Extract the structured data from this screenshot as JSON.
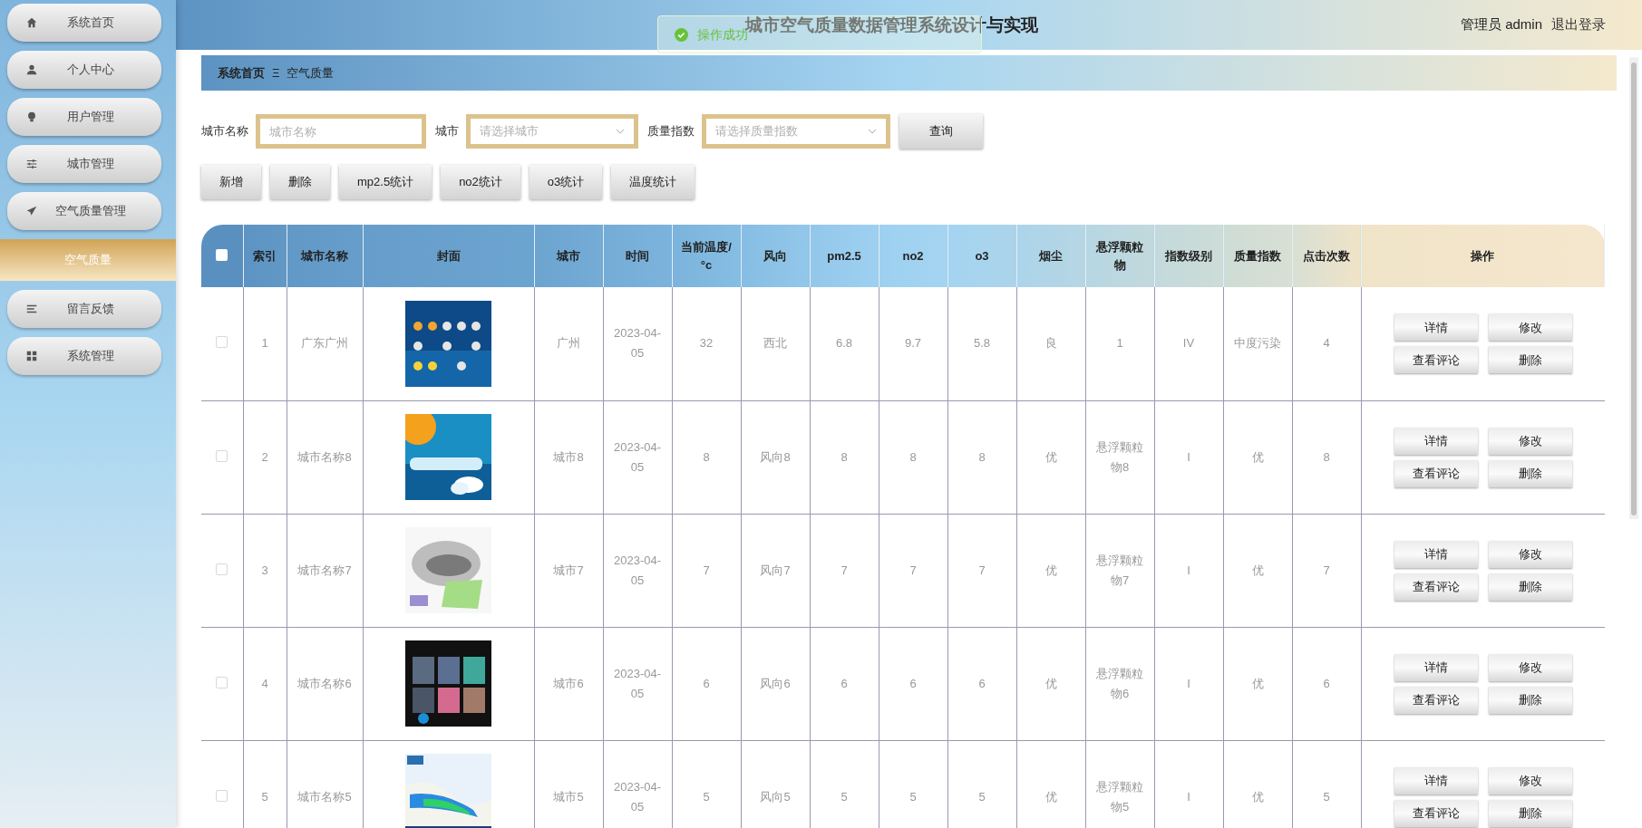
{
  "header": {
    "title": "城市空气质量数据管理系统设计与实现",
    "user": "管理员 admin",
    "logout": "退出登录"
  },
  "toast": {
    "text": "操作成功"
  },
  "sidebar": {
    "items": [
      {
        "label": "系统首页",
        "selected": false
      },
      {
        "label": "个人中心",
        "selected": false
      },
      {
        "label": "用户管理",
        "selected": false
      },
      {
        "label": "城市管理",
        "selected": false
      },
      {
        "label": "空气质量管理",
        "selected": false,
        "expanded": true,
        "children": [
          {
            "label": "空气质量",
            "selected": true
          }
        ]
      },
      {
        "label": "留言反馈",
        "selected": false
      },
      {
        "label": "系统管理",
        "selected": false
      }
    ]
  },
  "breadcrumb": [
    "系统首页",
    "空气质量"
  ],
  "breadcrumb_separator": "Ξ",
  "search": {
    "fields": [
      {
        "label": "城市名称",
        "kind": "text",
        "placeholder": "城市名称"
      },
      {
        "label": "城市",
        "kind": "select",
        "placeholder": "请选择城市"
      },
      {
        "label": "质量指数",
        "kind": "select",
        "placeholder": "请选择质量指数"
      }
    ],
    "button": "查询"
  },
  "toolbar": [
    "新增",
    "删除",
    "mp2.5统计",
    "no2统计",
    "o3统计",
    "温度统计"
  ],
  "table": {
    "select_all": false,
    "columns": [
      "索引",
      "城市名称",
      "封面",
      "城市",
      "时间",
      "当前温度/°c",
      "风向",
      "pm2.5",
      "no2",
      "o3",
      "烟尘",
      "悬浮颗粒物",
      "指数级别",
      "质量指数",
      "点击次数",
      "操作"
    ],
    "rows": [
      {
        "checked": false,
        "cells": [
          "1",
          "广东广州",
          {
            "kind": "picture"
          },
          "广州",
          "2023-04-05",
          "32",
          "西北",
          "6.8",
          "9.7",
          "5.8",
          "良",
          "1",
          "IV",
          "中度污染",
          "4"
        ],
        "actions": [
          "详情",
          "修改",
          "查看评论",
          "删除"
        ]
      },
      {
        "checked": false,
        "cells": [
          "2",
          "城市名称8",
          {
            "kind": "picture"
          },
          "城市8",
          "2023-04-05",
          "8",
          "风向8",
          "8",
          "8",
          "8",
          "优",
          "悬浮颗粒物8",
          "I",
          "优",
          "8"
        ],
        "actions": [
          "详情",
          "修改",
          "查看评论",
          "删除"
        ]
      },
      {
        "checked": false,
        "cells": [
          "3",
          "城市名称7",
          {
            "kind": "picture"
          },
          "城市7",
          "2023-04-05",
          "7",
          "风向7",
          "7",
          "7",
          "7",
          "优",
          "悬浮颗粒物7",
          "I",
          "优",
          "7"
        ],
        "actions": [
          "详情",
          "修改",
          "查看评论",
          "删除"
        ]
      },
      {
        "checked": false,
        "cells": [
          "4",
          "城市名称6",
          {
            "kind": "picture"
          },
          "城市6",
          "2023-04-05",
          "6",
          "风向6",
          "6",
          "6",
          "6",
          "优",
          "悬浮颗粒物6",
          "I",
          "优",
          "6"
        ],
        "actions": [
          "详情",
          "修改",
          "查看评论",
          "删除"
        ]
      },
      {
        "checked": false,
        "cells": [
          "5",
          "城市名称5",
          {
            "kind": "picture"
          },
          "城市5",
          "2023-04-05",
          "5",
          "风向5",
          "5",
          "5",
          "5",
          "优",
          "悬浮颗粒物5",
          "I",
          "优",
          "5"
        ],
        "actions": [
          "详情",
          "修改",
          "查看评论",
          "删除"
        ]
      }
    ]
  }
}
